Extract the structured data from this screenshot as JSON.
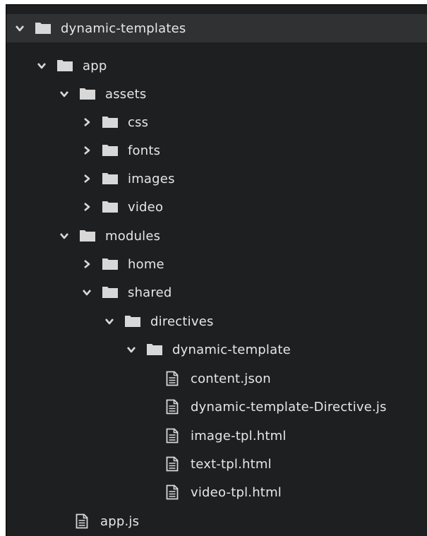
{
  "tree": {
    "nodes": [
      {
        "label": "dynamic-templates",
        "type": "folder",
        "expanded": true,
        "depth": 0
      },
      {
        "label": "app",
        "type": "folder",
        "expanded": true,
        "depth": 1
      },
      {
        "label": "assets",
        "type": "folder",
        "expanded": true,
        "depth": 2
      },
      {
        "label": "css",
        "type": "folder",
        "expanded": false,
        "depth": 3
      },
      {
        "label": "fonts",
        "type": "folder",
        "expanded": false,
        "depth": 3
      },
      {
        "label": "images",
        "type": "folder",
        "expanded": false,
        "depth": 3
      },
      {
        "label": "video",
        "type": "folder",
        "expanded": false,
        "depth": 3
      },
      {
        "label": "modules",
        "type": "folder",
        "expanded": true,
        "depth": 2
      },
      {
        "label": "home",
        "type": "folder",
        "expanded": false,
        "depth": 3
      },
      {
        "label": "shared",
        "type": "folder",
        "expanded": true,
        "depth": 3
      },
      {
        "label": "directives",
        "type": "folder",
        "expanded": true,
        "depth": 4
      },
      {
        "label": "dynamic-template",
        "type": "folder",
        "expanded": true,
        "depth": 5
      },
      {
        "label": "content.json",
        "type": "file",
        "depth": 6
      },
      {
        "label": "dynamic-template-Directive.js",
        "type": "file",
        "depth": 6
      },
      {
        "label": "image-tpl.html",
        "type": "file",
        "depth": 6
      },
      {
        "label": "text-tpl.html",
        "type": "file",
        "depth": 6
      },
      {
        "label": "video-tpl.html",
        "type": "file",
        "depth": 6
      },
      {
        "label": "app.js",
        "type": "file",
        "depth": 2
      }
    ]
  },
  "colors": {
    "background": "#1d1f21",
    "selected_row": "#2f3133",
    "text": "#e6e6e6",
    "icon": "#d8d8d8"
  }
}
